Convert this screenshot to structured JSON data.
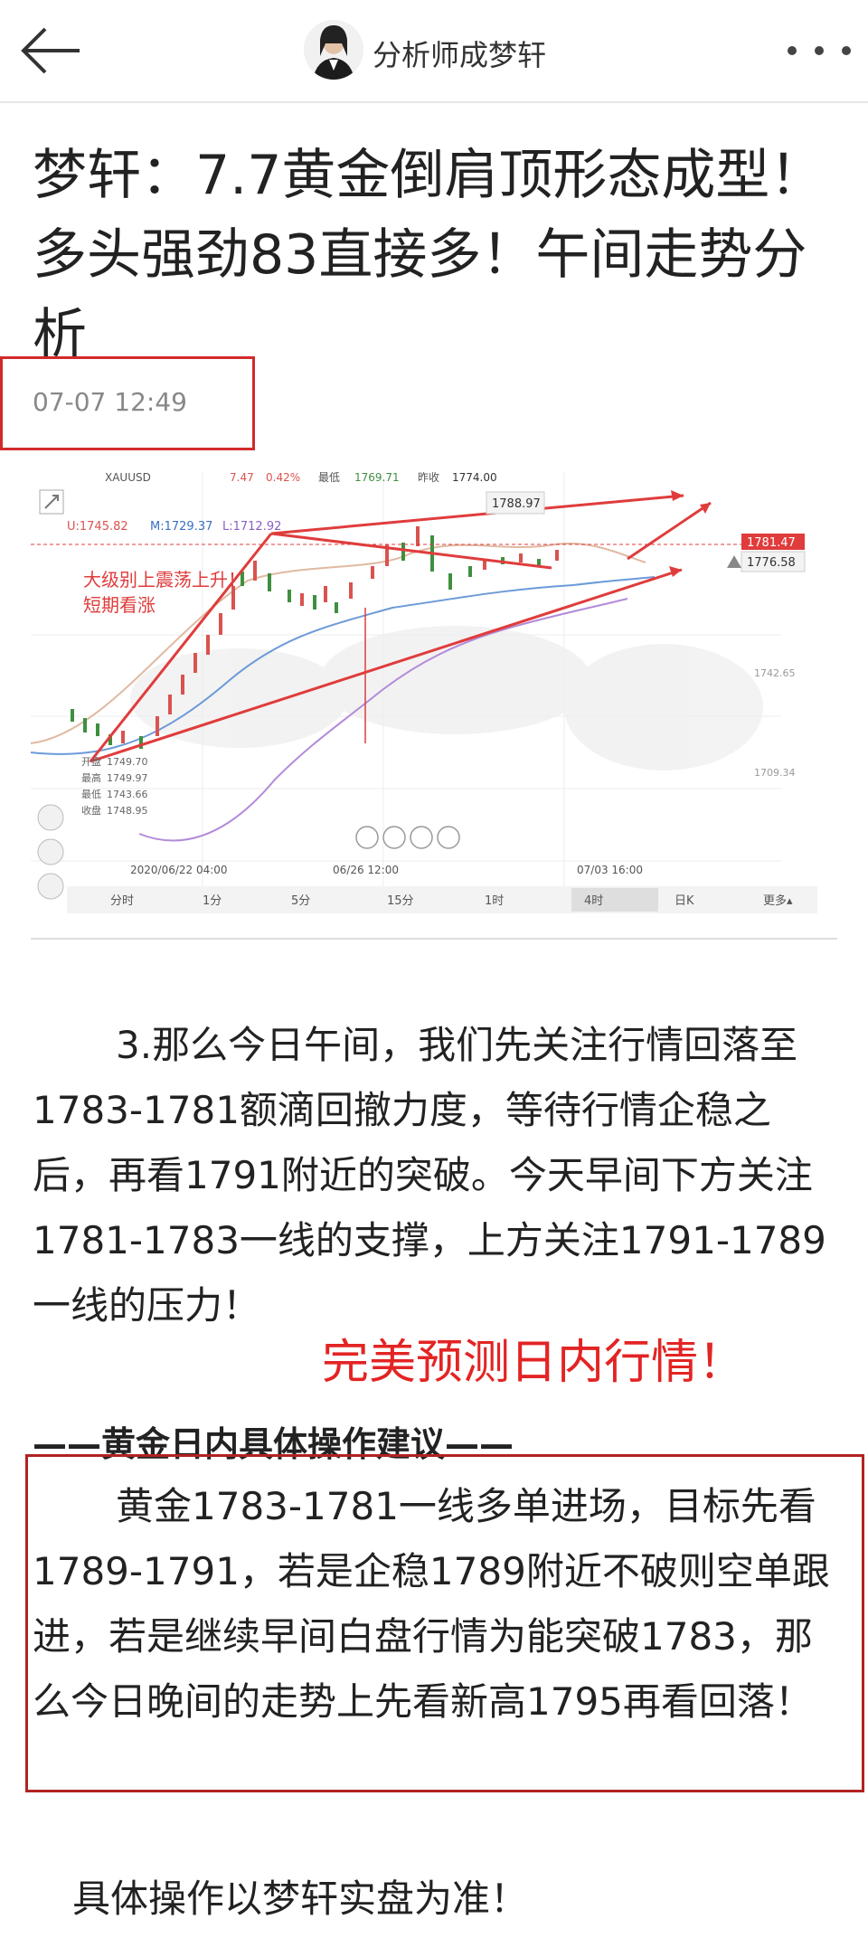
{
  "header": {
    "author": "分析师成梦轩",
    "back_icon": "arrow-left-icon",
    "more_icon": "more-dots-icon"
  },
  "article": {
    "title": "梦轩：7.7黄金倒肩顶形态成型！多头强劲83直接多！午间走势分析",
    "date": "07-07 12:49"
  },
  "chart": {
    "symbol": "XAUUSD",
    "change": "7.47",
    "change_pct": "0.42%",
    "hi_label": "最低",
    "hi_value": "1769.71",
    "prev_label": "昨收",
    "prev_value": "1774.00",
    "ma_u": "U:1745.82",
    "ma_m": "M:1729.37",
    "ma_l": "L:1712.92",
    "annotation_line1": "大级别上震荡上升！",
    "annotation_line2": "短期看涨",
    "peak_label": "1788.97",
    "current_price_tag": "1781.47",
    "right_price": "1776.58",
    "axis_price_1": "1742.65",
    "axis_price_2": "1709.34",
    "ohlc": [
      {
        "label": "开盘",
        "value": "1749.70"
      },
      {
        "label": "最高",
        "value": "1749.97"
      },
      {
        "label": "最低",
        "value": "1743.66"
      },
      {
        "label": "收盘",
        "value": "1748.95"
      }
    ],
    "date_axis": [
      "2020/06/22 04:00",
      "06/26 12:00",
      "07/03 16:00"
    ],
    "timeframes": [
      "分时",
      "1分",
      "5分",
      "15分",
      "1时",
      "4时",
      "日K",
      "更多▴"
    ],
    "active_timeframe": "4时",
    "colors": {
      "trend": "#e03c3c",
      "up": "#d9534f",
      "down": "#3f8f3f"
    }
  },
  "body": {
    "para1": "3.那么今日午间，我们先关注行情回落至1783-1781额滴回撤力度，等待行情企稳之后，再看1791附近的突破。今天早间下方关注1781-1783一线的支撑，上方关注1791-1789一线的压力！",
    "highlight": "完美预测日内行情！",
    "section_heading": "——黄金日内具体操作建议——",
    "advice": "黄金1783-1781一线多单进场，目标先看1789-1791，若是企稳1789附近不破则空单跟进，若是继续早间白盘行情为能突破1783，那么今日晚间的走势上先看新高1795再看回落！",
    "footer_note": "具体操作以梦轩实盘为准！"
  }
}
